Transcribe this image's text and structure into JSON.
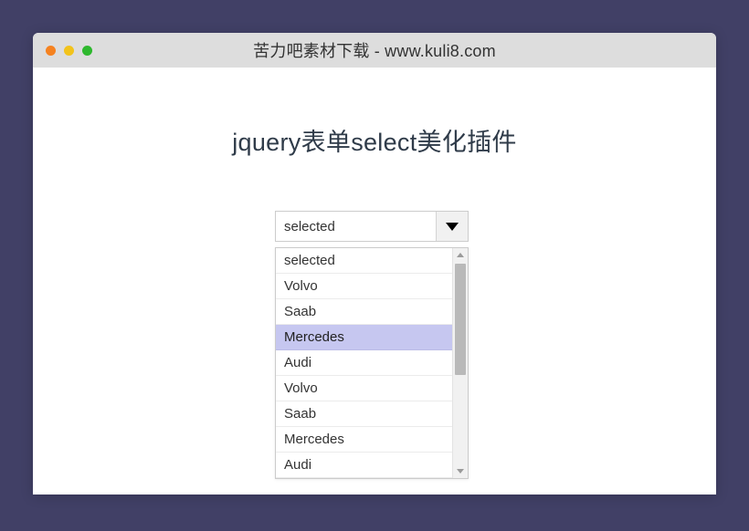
{
  "window": {
    "title": "苦力吧素材下载 - www.kuli8.com",
    "traffic_lights": [
      {
        "name": "close",
        "color": "#f58220"
      },
      {
        "name": "minimize",
        "color": "#f2c31b"
      },
      {
        "name": "maximize",
        "color": "#2eb82e"
      }
    ]
  },
  "page": {
    "heading": "jquery表单select美化插件",
    "background": "#ffffff"
  },
  "select": {
    "value": "selected",
    "arrow_icon": "chevron-down-icon",
    "expanded": true,
    "highlighted_index": 3,
    "highlight_color": "#c6c7f0",
    "options": [
      {
        "label": "selected",
        "highlighted": false
      },
      {
        "label": "Volvo",
        "highlighted": false
      },
      {
        "label": "Saab",
        "highlighted": false
      },
      {
        "label": "Mercedes",
        "highlighted": true
      },
      {
        "label": "Audi",
        "highlighted": false
      },
      {
        "label": "Volvo",
        "highlighted": false
      },
      {
        "label": "Saab",
        "highlighted": false
      },
      {
        "label": "Mercedes",
        "highlighted": false
      },
      {
        "label": "Audi",
        "highlighted": false
      }
    ],
    "scrollbar": {
      "up_icon": "caret-up-icon",
      "down_icon": "caret-down-icon",
      "thumb_color": "#b9b9b9",
      "track_color": "#f1f1f1"
    }
  },
  "desktop": {
    "background": "#414066"
  }
}
